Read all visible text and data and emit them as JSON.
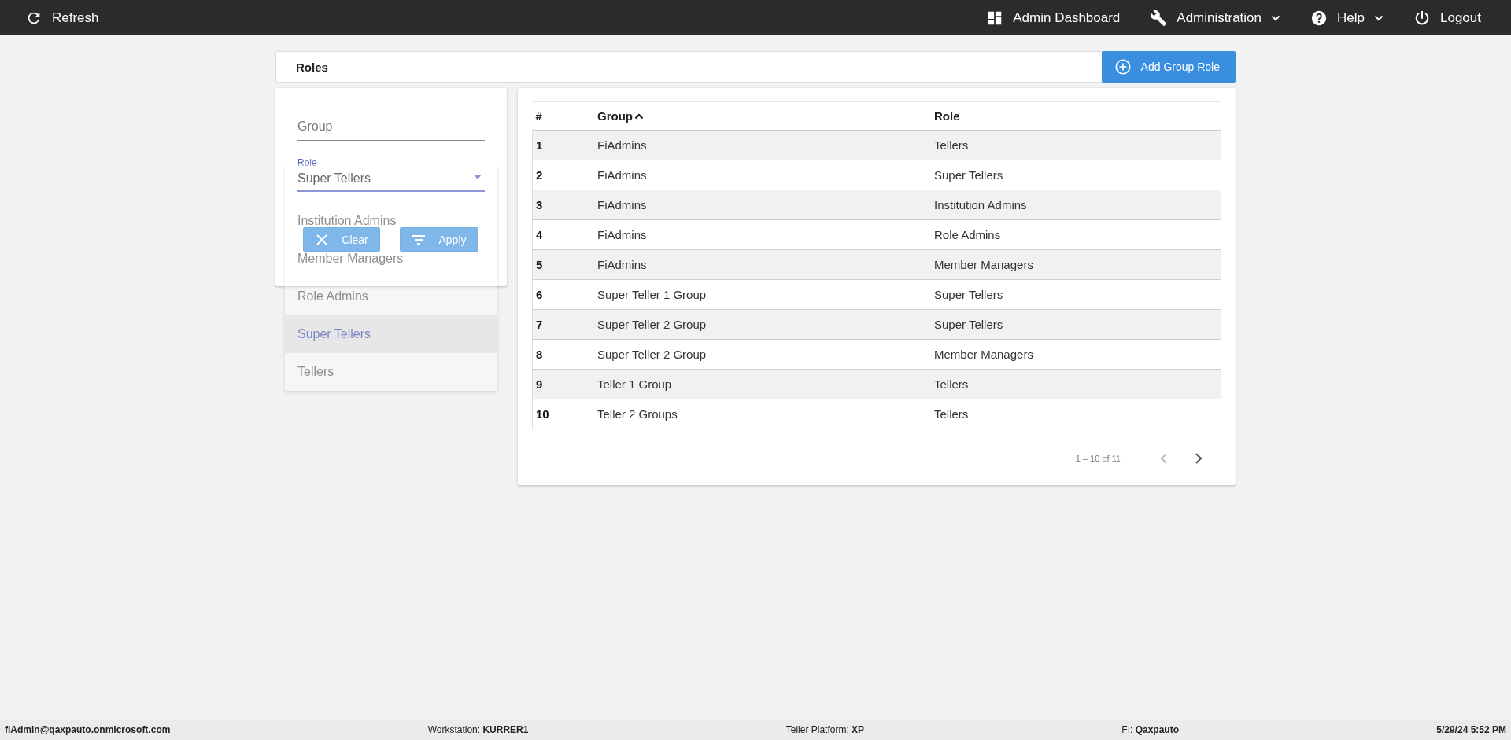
{
  "topbar": {
    "left": [
      {
        "kind": "refresh",
        "label": "Refresh",
        "dropdown": false
      }
    ],
    "right": [
      {
        "kind": "dashboard",
        "label": "Admin Dashboard",
        "dropdown": false
      },
      {
        "kind": "wrench",
        "label": "Administration",
        "dropdown": true
      },
      {
        "kind": "help",
        "label": "Help",
        "dropdown": true
      },
      {
        "kind": "power",
        "label": "Logout",
        "dropdown": false
      }
    ]
  },
  "page": {
    "title": "Roles",
    "add_button": "Add Group Role"
  },
  "filters": {
    "group": {
      "placeholder": "Group"
    },
    "role": {
      "label": "Role",
      "value": "Super Tellers"
    },
    "role_options": [
      {
        "label": "Institution Admins",
        "selected": false
      },
      {
        "label": "Member Managers",
        "selected": false
      },
      {
        "label": "Role Admins",
        "selected": false
      },
      {
        "label": "Super Tellers",
        "selected": true
      },
      {
        "label": "Tellers",
        "selected": false
      }
    ],
    "buttons": [
      {
        "kind": "clear",
        "label": "Clear"
      },
      {
        "kind": "apply",
        "label": "Apply"
      }
    ]
  },
  "table": {
    "columns": [
      {
        "label": "#",
        "sorted": false
      },
      {
        "label": "Group",
        "sorted": true
      },
      {
        "label": "Role",
        "sorted": false
      }
    ],
    "rows": [
      [
        "1",
        "FiAdmins",
        "Tellers"
      ],
      [
        "2",
        "FiAdmins",
        "Super Tellers"
      ],
      [
        "3",
        "FiAdmins",
        "Institution Admins"
      ],
      [
        "4",
        "FiAdmins",
        "Role Admins"
      ],
      [
        "5",
        "FiAdmins",
        "Member Managers"
      ],
      [
        "6",
        "Super Teller 1 Group",
        "Super Tellers"
      ],
      [
        "7",
        "Super Teller 2 Group",
        "Super Tellers"
      ],
      [
        "8",
        "Super Teller 2 Group",
        "Member Managers"
      ],
      [
        "9",
        "Teller 1 Group",
        "Tellers"
      ],
      [
        "10",
        "Teller 2 Groups",
        "Tellers"
      ]
    ]
  },
  "pagination": {
    "range": "1 – 10 of 11",
    "prev_disabled": true,
    "next_disabled": false
  },
  "status_bar": [
    {
      "value": "fiAdmin@qaxpauto.onmicrosoft.com"
    },
    {
      "label": "Workstation:",
      "value": "KURRER1"
    },
    {
      "label": "Teller Platform:",
      "value": "XP"
    },
    {
      "label": "FI:",
      "value": "Qaxpauto"
    },
    {
      "value": "5/29/24 5:52 PM"
    }
  ]
}
